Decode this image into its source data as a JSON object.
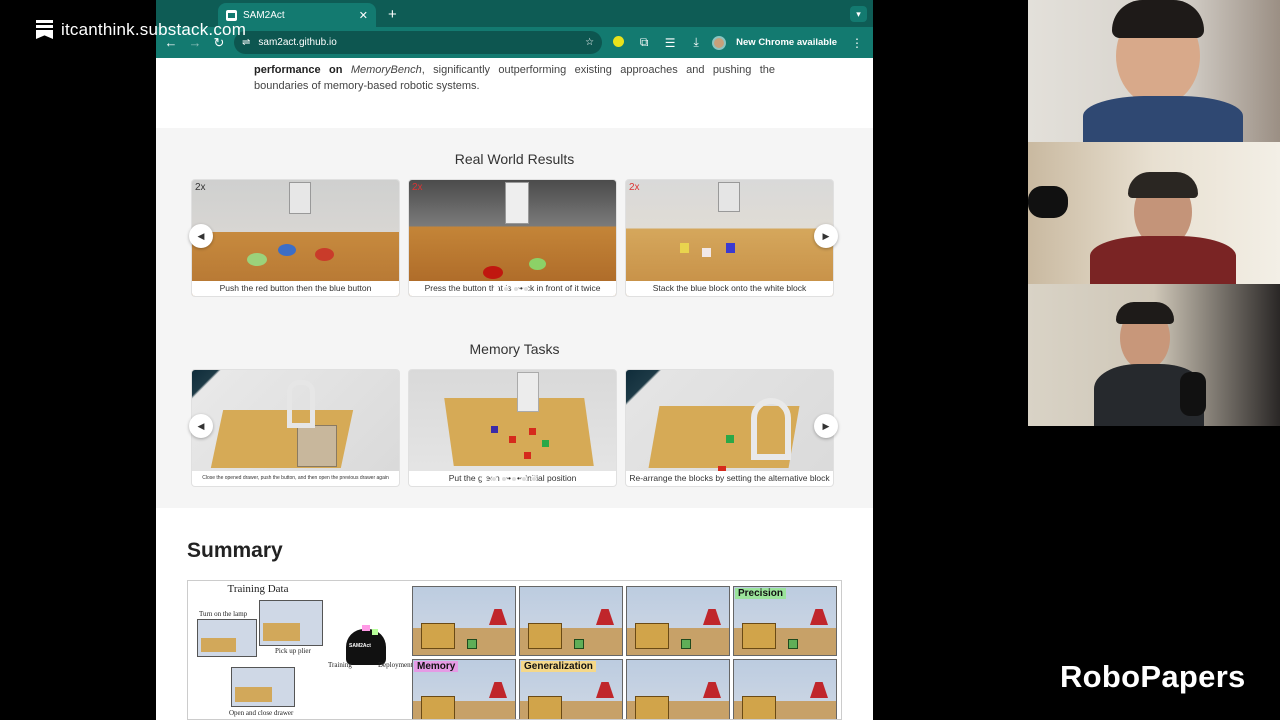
{
  "watermark": {
    "text": "itcanthink.substack.com",
    "icon": "substack-icon"
  },
  "browser": {
    "tab_title": "SAM2Act",
    "tab_close": "✕",
    "new_tab": "+",
    "url": "sam2act.github.io",
    "update_label": "New Chrome available",
    "theme_color": "#137a70"
  },
  "page": {
    "abstract_bold": "performance on",
    "abstract_em": "MemoryBench",
    "abstract_rest": ", significantly outperforming existing approaches and pushing the boundaries of memory-based robotic systems.",
    "real_world_title": "Real World Results",
    "real_world_cards": [
      {
        "speed": "2x",
        "caption": "Push the red button then the blue button"
      },
      {
        "speed": "2x",
        "caption": "Press the button that is ••••ck in front of it twice"
      },
      {
        "speed": "2x",
        "caption": "Stack the blue block onto the white block"
      }
    ],
    "memory_title": "Memory Tasks",
    "memory_cards": [
      {
        "caption": "Close the opened drawer, push the button, and then open the previous drawer again"
      },
      {
        "caption": "Put the green ••••••• initial position"
      },
      {
        "caption": "Re-arrange the blocks by setting the alternative block"
      }
    ],
    "summary_title": "Summary",
    "figure": {
      "training_data": "Training Data",
      "task_labels": [
        "Turn on the lamp",
        "Pick up plier",
        "Open and close drawer"
      ],
      "model_name": "SAM2Act",
      "arrow_labels": [
        "Training",
        "Deployment"
      ],
      "tags": [
        "Precision",
        "Memory",
        "Generalization"
      ]
    }
  },
  "overlay": {
    "brand": "RoboPapers"
  }
}
